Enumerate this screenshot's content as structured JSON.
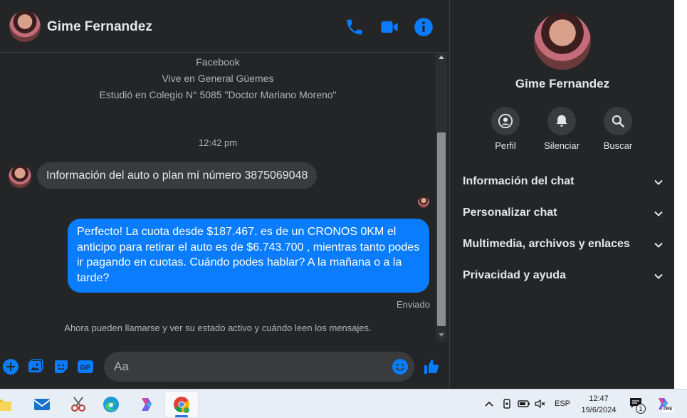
{
  "header": {
    "contact_name": "Gime Fernandez"
  },
  "profile_intro": {
    "lines": [
      "Facebook",
      "Vive en General Güemes",
      "Estudió en Colegio N° 5085 \"Doctor Mariano Moreno\""
    ]
  },
  "conversation": {
    "time_separator": "12:42 pm",
    "incoming": "Información del auto o plan mí número 3875069048",
    "outgoing": "Perfecto! La cuota desde $187.467. es de un CRONOS 0KM el anticipo para retirar el auto es de $6.743.700 , mientras tanto podes ir pagando en cuotas. Cuándo podes hablar? A la mañana o a la tarde?",
    "status": "Enviado",
    "notice": "Ahora pueden llamarse y ver su estado activo y cuándo leen los mensajes."
  },
  "composer": {
    "placeholder": "Aa"
  },
  "sidebar": {
    "name": "Gime Fernandez",
    "actions": [
      {
        "label": "Perfil",
        "icon": "profile-icon"
      },
      {
        "label": "Silenciar",
        "icon": "bell-icon"
      },
      {
        "label": "Buscar",
        "icon": "search-icon"
      }
    ],
    "sections": [
      "Información del chat",
      "Personalizar chat",
      "Multimedia, archivos y enlaces",
      "Privacidad y ayuda"
    ]
  },
  "taskbar": {
    "language": "ESP",
    "time": "12:47",
    "date": "19/6/2024",
    "notification_count": "1",
    "copilot_badge": "PRE"
  },
  "colors": {
    "accent": "#0a7cff",
    "background": "#242526",
    "bubble_in": "#3a3b3c"
  }
}
